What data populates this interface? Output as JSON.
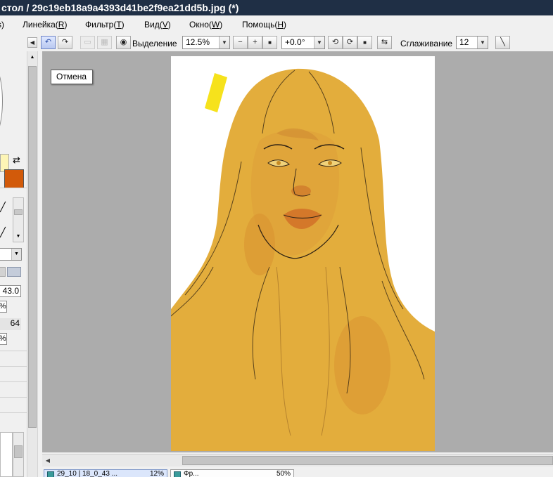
{
  "window": {
    "title": "стол / 29c19eb18a9a4393d41be2f9ea21dd5b.jpg (*)"
  },
  "menu": [
    {
      "label": "s)",
      "key": ""
    },
    {
      "label": "Линейка(",
      "key": "R",
      "tail": ")"
    },
    {
      "label": "Фильтр(",
      "key": "T",
      "tail": ")"
    },
    {
      "label": "Вид(",
      "key": "V",
      "tail": ")"
    },
    {
      "label": "Окно(",
      "key": "W",
      "tail": ")"
    },
    {
      "label": "Помощь(",
      "key": "H",
      "tail": ")"
    }
  ],
  "toolbar": {
    "undo_icon": "↶",
    "redo_icon": "↷",
    "selection_label": "Выделение",
    "zoom_value": "12.5%",
    "zoom_out": "−",
    "zoom_in": "+",
    "zoom_reset": "■",
    "rotation_value": "+0.0°",
    "rotate_ccw": "⟲",
    "rotate_cw": "⟳",
    "rotate_reset": "■",
    "flip_icon": "⇆",
    "smoothing_label": "Сглаживание",
    "smoothing_value": "12",
    "pen_icon": "╲"
  },
  "tooltip": {
    "text": "Отмена"
  },
  "left_panel": {
    "brush_size": "43.0",
    "percent_a": "%",
    "density": "64",
    "percent_b": "%",
    "primary_color": "#fdf5b6",
    "secondary_color": "#d25a0a"
  },
  "canvas": {
    "background": "#acacac",
    "skin_color": "#e3ad3c"
  },
  "tabs": [
    {
      "label": "29_10 | 18_0_43 ...",
      "percent": "12%"
    },
    {
      "label": "Фр...",
      "percent": "50%"
    }
  ]
}
